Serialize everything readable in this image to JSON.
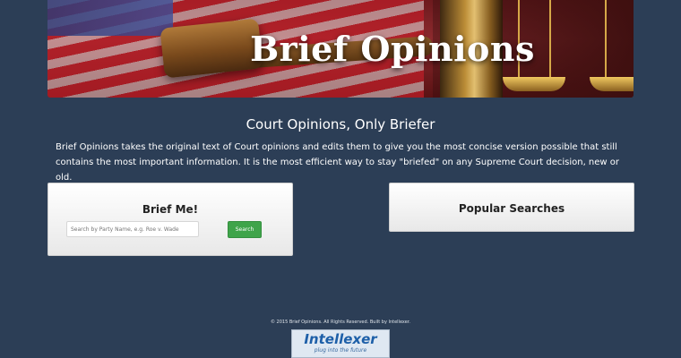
{
  "hero": {
    "title": "Brief Opinions"
  },
  "tagline": "Court Opinions, Only Briefer",
  "intro": "Brief Opinions takes the original text of Court opinions and edits them to give you the most concise version possible that still contains the most important information. It is the most efficient way to stay \"briefed\" on any Supreme Court decision, new or old.",
  "brief_card": {
    "title": "Brief Me!",
    "search_placeholder": "Search by Party Name, e.g. Roe v. Wade",
    "search_button": "Search"
  },
  "popular_card": {
    "title": "Popular Searches"
  },
  "footer": {
    "copyright": "© 2015 Brief Opinions. All Rights Reserved. Built by Intellexer.",
    "logo_name": "Intellexer",
    "logo_tagline": "plug into the future"
  },
  "colors": {
    "background": "#2c3e56",
    "button_green": "#3fa44a",
    "logo_blue": "#1d5fa8"
  }
}
